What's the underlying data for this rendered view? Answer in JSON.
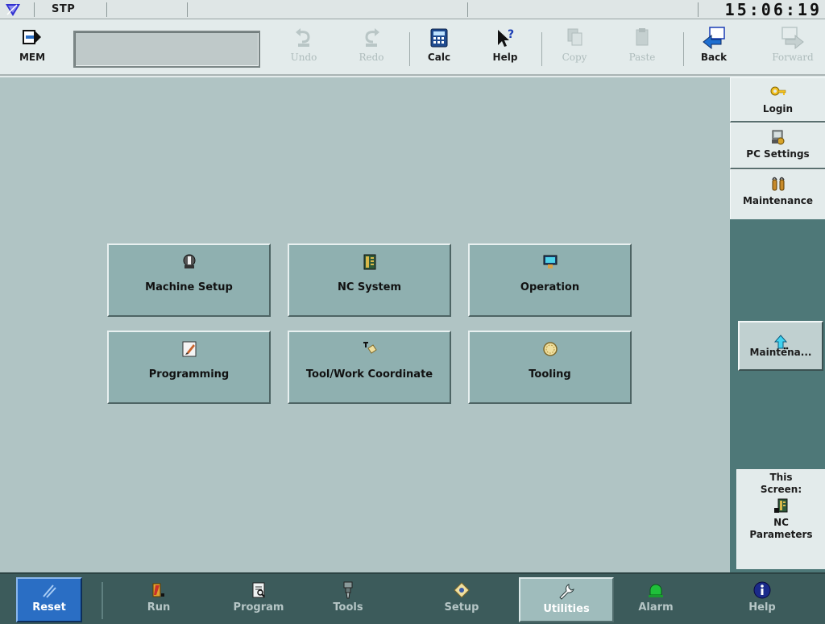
{
  "status_bar": {
    "mode": "STP",
    "time": "15:06:19",
    "logo_icon": "machine-logo-icon"
  },
  "toolbar": {
    "mem_label": "MEM",
    "mem_input_value": "",
    "undo_label": "Undo",
    "redo_label": "Redo",
    "calc_label": "Calc",
    "help_label": "Help",
    "copy_label": "Copy",
    "paste_label": "Paste",
    "back_label": "Back",
    "forward_label": "Forward"
  },
  "main": {
    "buttons": [
      {
        "label": "Machine Setup",
        "icon": "machine-setup-icon"
      },
      {
        "label": "NC System",
        "icon": "nc-system-icon"
      },
      {
        "label": "Operation",
        "icon": "operation-icon"
      },
      {
        "label": "Programming",
        "icon": "programming-icon"
      },
      {
        "label": "Tool/Work Coordinate",
        "icon": "tool-work-coordinate-icon"
      },
      {
        "label": "Tooling",
        "icon": "tooling-icon"
      }
    ]
  },
  "sidebar": {
    "login_label": "Login",
    "pc_settings_label": "PC Settings",
    "maintenance_label": "Maintenance",
    "maint_button_label": "Maintena...",
    "this_screen_line1": "This",
    "this_screen_line2": "Screen:",
    "this_screen_line3": "NC",
    "this_screen_line4": "Parameters"
  },
  "bottom_bar": {
    "reset_label": "Reset",
    "tabs": [
      {
        "label": "Run",
        "icon": "run-icon"
      },
      {
        "label": "Program",
        "icon": "program-icon"
      },
      {
        "label": "Tools",
        "icon": "tools-icon"
      },
      {
        "label": "Setup",
        "icon": "setup-icon"
      },
      {
        "label": "Utilities",
        "icon": "wrench-icon",
        "active": true
      },
      {
        "label": "Alarm",
        "icon": "alarm-icon"
      },
      {
        "label": "Help",
        "icon": "info-icon"
      }
    ]
  },
  "colors": {
    "main_bg": "#b0c4c4",
    "sidebar_bg": "#4e7878",
    "bottom_bar_bg": "#3c5b5b",
    "reset_blue": "#2a6ec4"
  }
}
